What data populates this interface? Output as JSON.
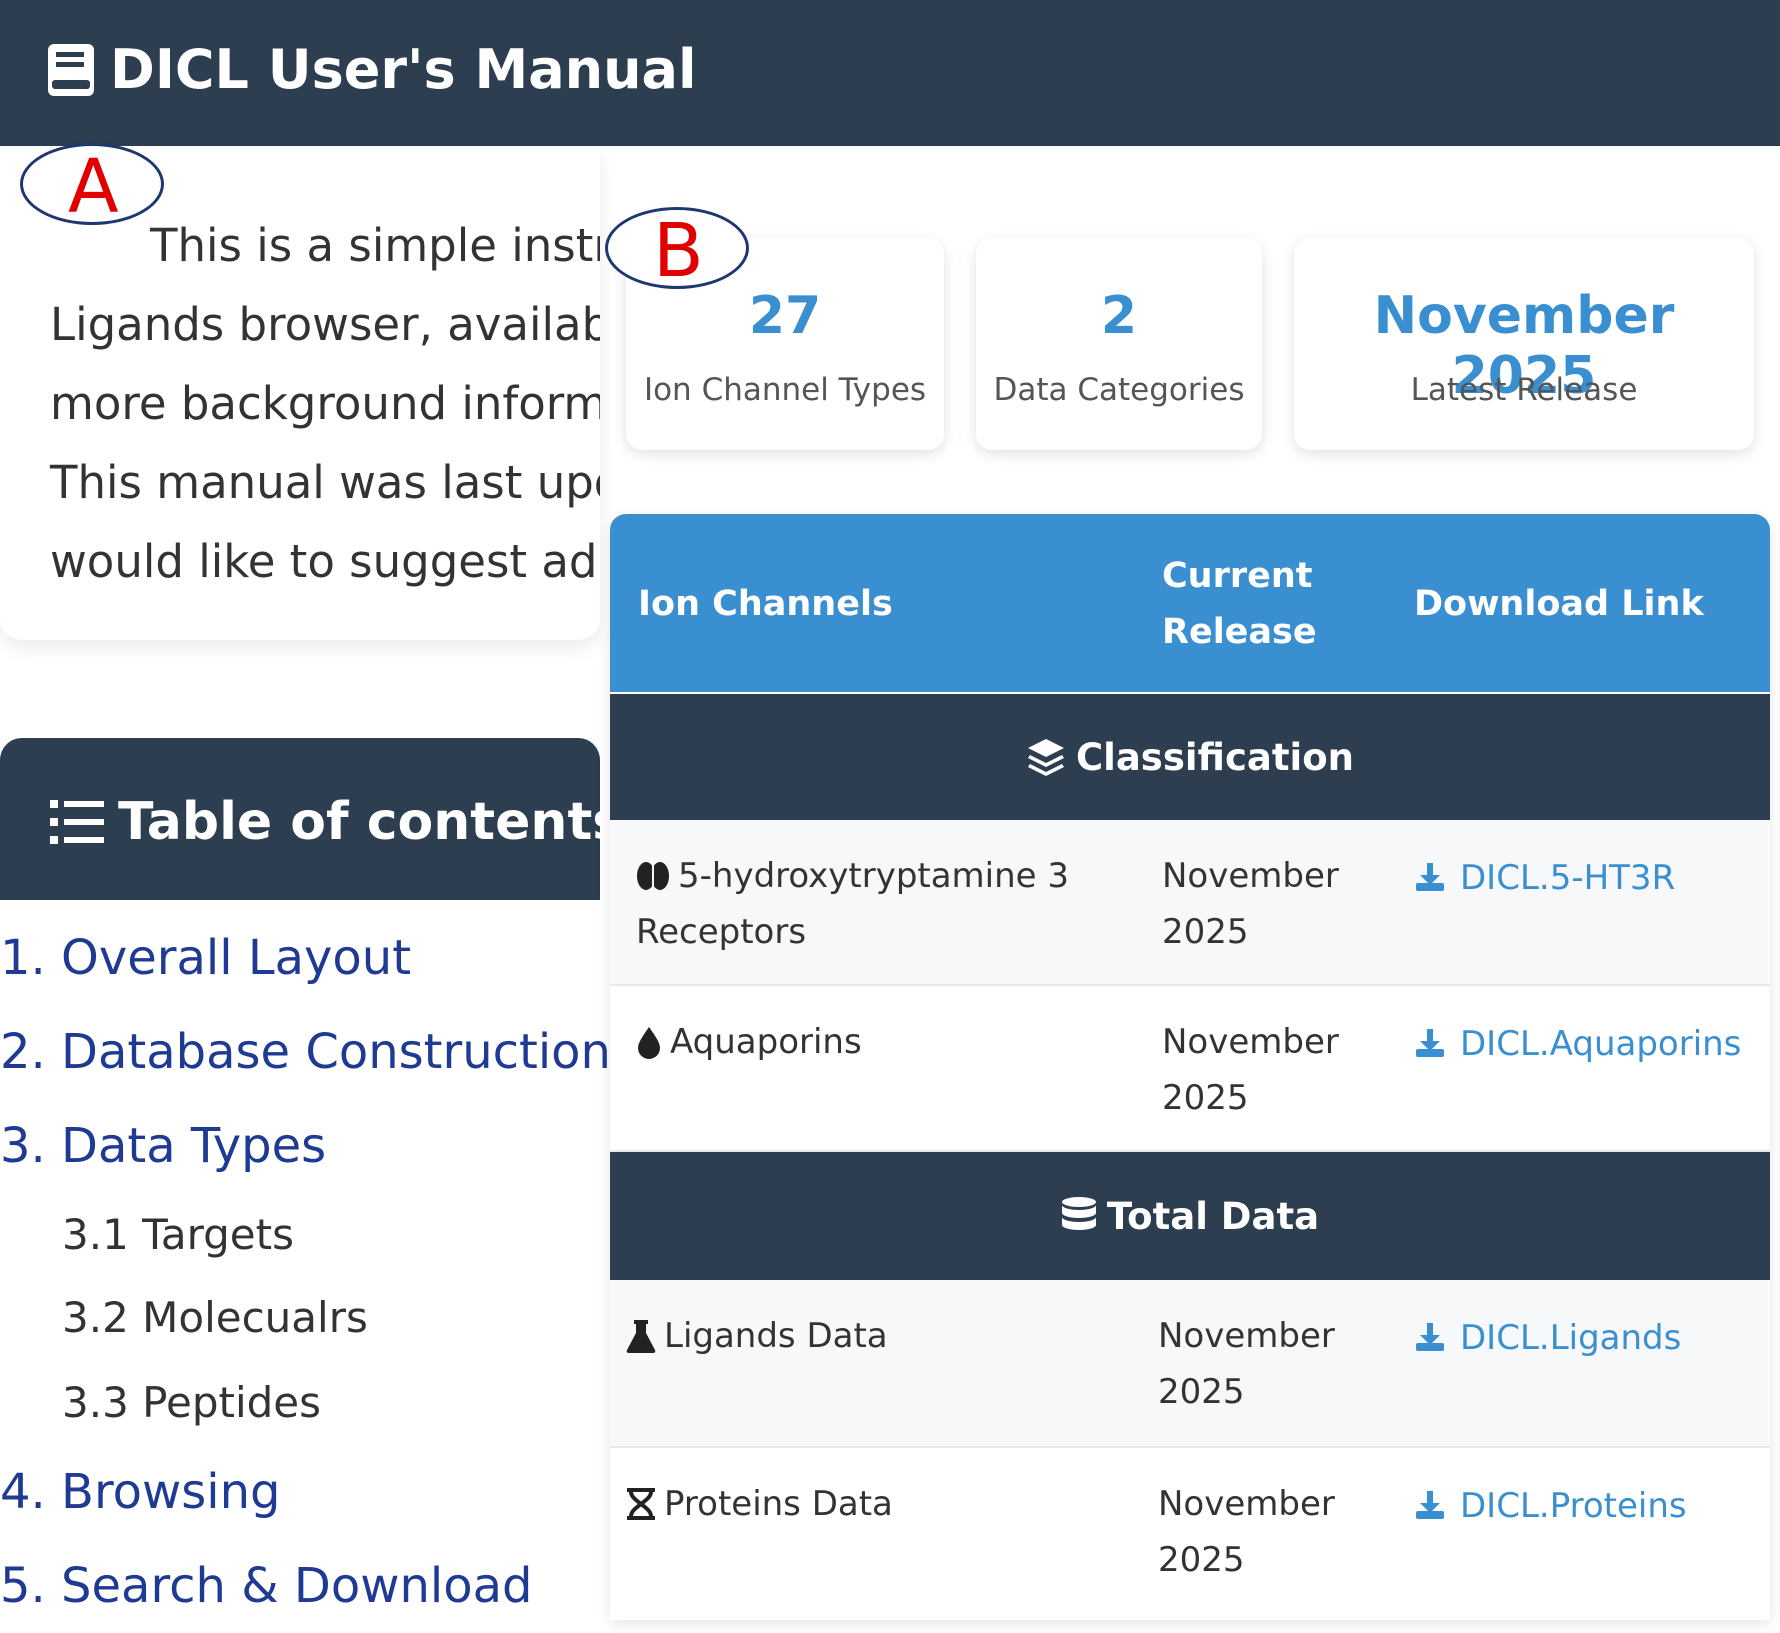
{
  "header": {
    "title": "DICL User's Manual",
    "icon": "book-icon"
  },
  "intro": {
    "lines": [
      "This is a simple instru",
      "Ligands browser, availabl",
      "more background inform",
      "This manual was last upd",
      "would like to suggest adc"
    ]
  },
  "annotations": {
    "a": "A",
    "b": "B"
  },
  "toc": {
    "title": "Table of contents",
    "items": [
      {
        "label": "1. Overall Layout"
      },
      {
        "label": "2. Database Construction"
      },
      {
        "label": "3. Data Types"
      },
      {
        "label": "3.1 Targets"
      },
      {
        "label": "3.2 Molecualrs"
      },
      {
        "label": "3.3 Peptides"
      },
      {
        "label": "4. Browsing"
      },
      {
        "label": "5. Search & Download"
      }
    ]
  },
  "stats": [
    {
      "value": "27",
      "label": "Ion Channel Types"
    },
    {
      "value": "2",
      "label": "Data Categories"
    },
    {
      "value": "November 2025",
      "label": "Latest Release"
    }
  ],
  "table": {
    "headers": {
      "col1": "Ion Channels",
      "col2_line1": "Current",
      "col2_line2": "Release",
      "col3": "Download Link"
    },
    "sections": [
      {
        "title": "Classification",
        "icon": "layers-icon",
        "rows": [
          {
            "name_line1": "5-hydroxytryptamine 3",
            "name_line2": "Receptors",
            "icon": "brain-icon",
            "release_line1": "November",
            "release_line2": "2025",
            "link": "DICL.5-HT3R"
          },
          {
            "name_line1": "Aquaporins",
            "name_line2": "",
            "icon": "droplet-icon",
            "release_line1": "November",
            "release_line2": "2025",
            "link": "DICL.Aquaporins"
          }
        ]
      },
      {
        "title": "Total Data",
        "icon": "database-icon",
        "rows": [
          {
            "name_line1": "Ligands Data",
            "name_line2": "",
            "icon": "flask-icon",
            "release_line1": "November",
            "release_line2": "2025",
            "link": "DICL.Ligands"
          },
          {
            "name_line1": "Proteins Data",
            "name_line2": "",
            "icon": "dna-icon",
            "release_line1": "November",
            "release_line2": "2025",
            "link": "DICL.Proteins"
          }
        ]
      }
    ]
  },
  "colors": {
    "dark": "#2c3e50",
    "accent": "#3a8fd0",
    "link": "#1f3a93",
    "annotation": "#e00000"
  }
}
